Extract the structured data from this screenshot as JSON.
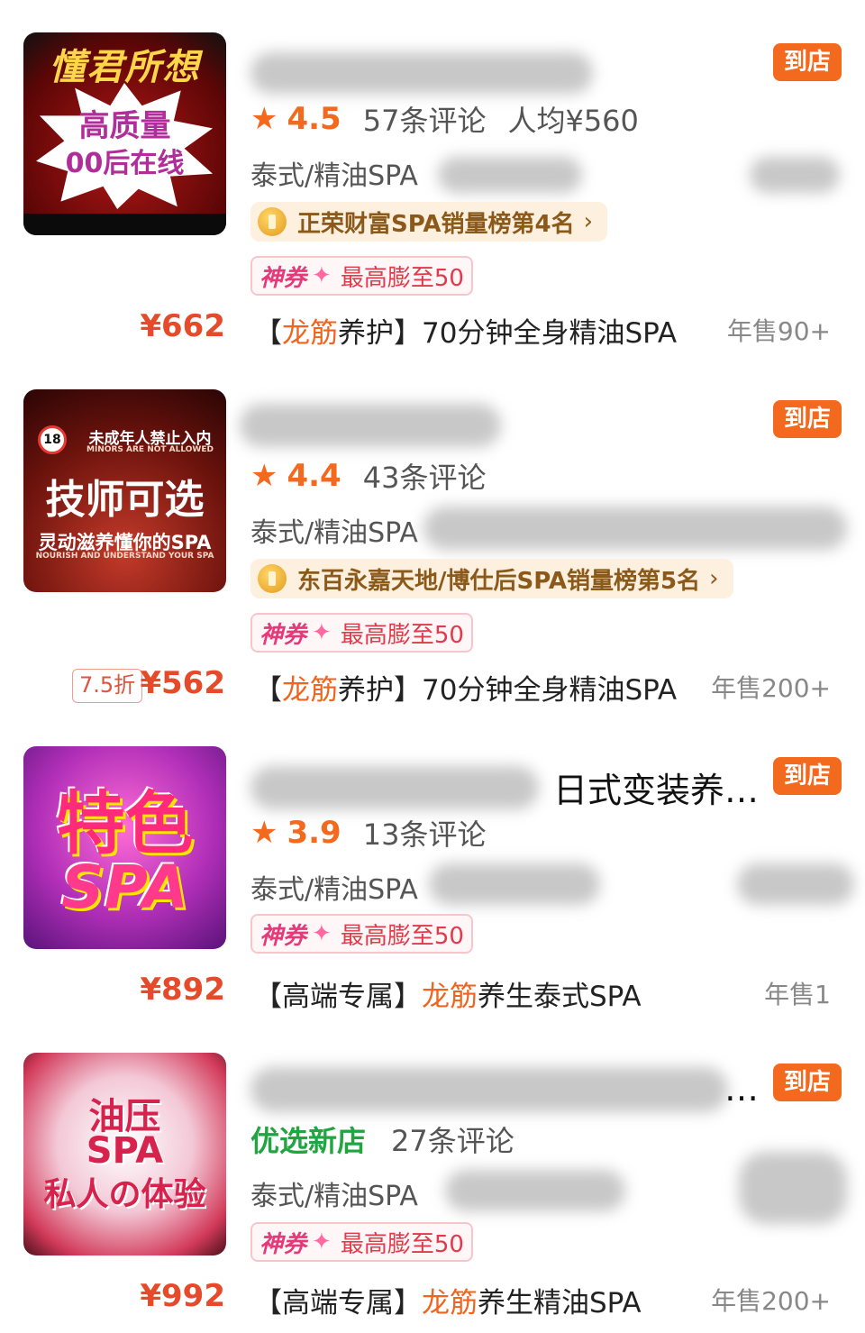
{
  "listings": [
    {
      "image": {
        "lines": [
          "懂君所想",
          "高质量",
          "00后在线"
        ]
      },
      "title_visible": "",
      "store_badge": "到店",
      "rating": "4.5",
      "reviews": "57条评论",
      "avg_price": "人均¥560",
      "category": "泰式/精油SPA",
      "rank": "正荣财富SPA销量榜第4名",
      "coupon": {
        "tag": "神券",
        "text": "最高膨至50"
      },
      "deal": {
        "discount": "",
        "price": "¥662",
        "name_prefix": "【",
        "name_hl": "龙筋",
        "name_rest": "养护】70分钟全身精油SPA",
        "sales": "年售90+"
      }
    },
    {
      "image": {
        "lines": [
          "未成年人禁止入内",
          "MINORS ARE NOT ALLOWED",
          "技师可选",
          "灵动滋养懂你的SPA",
          "NOURISH AND UNDERSTAND YOUR SPA"
        ]
      },
      "title_visible": "",
      "store_badge": "到店",
      "rating": "4.4",
      "reviews": "43条评论",
      "avg_price": "",
      "category": "泰式/精油SPA",
      "rank": "东百永嘉天地/博仕后SPA销量榜第5名",
      "coupon": {
        "tag": "神券",
        "text": "最高膨至50"
      },
      "deal": {
        "discount": "7.5折",
        "price": "¥562",
        "name_prefix": "【",
        "name_hl": "龙筋",
        "name_rest": "养护】70分钟全身精油SPA",
        "sales": "年售200+"
      }
    },
    {
      "image": {
        "lines": [
          "特色",
          "SPA"
        ]
      },
      "title_visible": "日式变装养…",
      "store_badge": "到店",
      "rating": "3.9",
      "reviews": "13条评论",
      "avg_price": "",
      "category": "泰式/精油SPA",
      "rank": "",
      "coupon": {
        "tag": "神券",
        "text": "最高膨至50"
      },
      "deal": {
        "discount": "",
        "price": "¥892",
        "name_prefix": "【高端专属】",
        "name_hl": "龙筋",
        "name_rest": "养生泰式SPA",
        "sales": "年售1"
      }
    },
    {
      "image": {
        "lines": [
          "油压",
          "SPA",
          "私人の体验"
        ]
      },
      "title_visible": "…",
      "store_badge": "到店",
      "rating": "",
      "new_shop": "优选新店",
      "reviews": "27条评论",
      "avg_price": "",
      "category": "泰式/精油SPA",
      "rank": "",
      "coupon": {
        "tag": "神券",
        "text": "最高膨至50"
      },
      "deal": {
        "discount": "",
        "price": "¥992",
        "name_prefix": "【高端专属】",
        "name_hl": "龙筋",
        "name_rest": "养生精油SPA",
        "sales": "年售200+"
      }
    }
  ],
  "colors": {
    "accent": "#f36a1f",
    "price": "#e54b2a",
    "new_shop": "#21a540",
    "coupon": "#e23a4a"
  },
  "icons": {
    "rating": "star-icon",
    "rank": "medal-icon",
    "rank_more": "chevron-right-icon",
    "coupon": "sparkle-icon"
  }
}
